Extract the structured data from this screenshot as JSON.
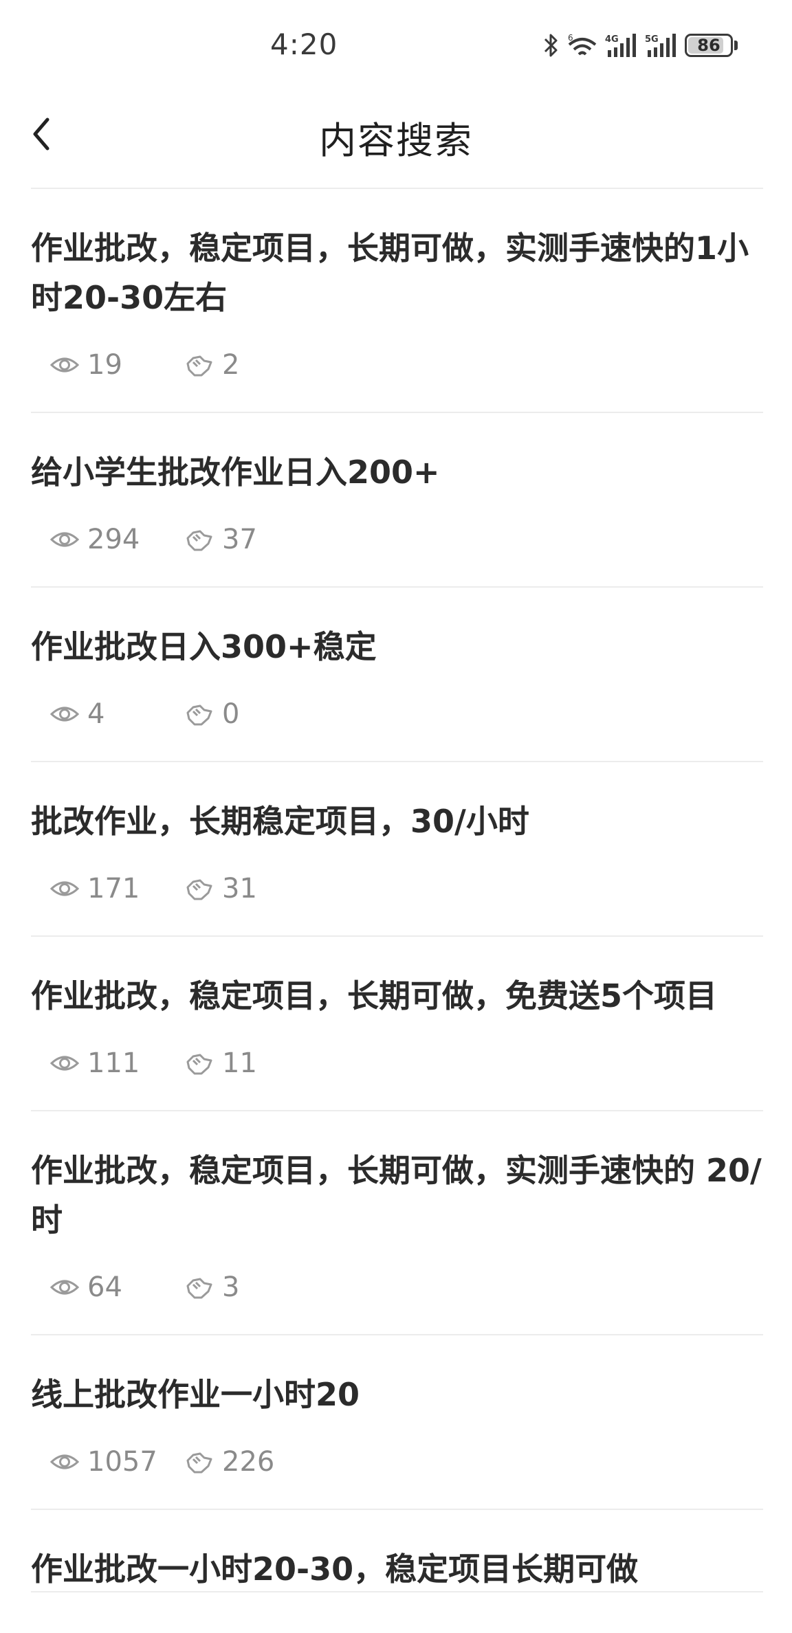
{
  "status": {
    "time": "4:20",
    "battery": "86"
  },
  "header": {
    "title": "内容搜索"
  },
  "results": [
    {
      "title": "作业批改，稳定项目，长期可做，实测手速快的1小时20-30左右",
      "views": "19",
      "likes": "2"
    },
    {
      "title": "给小学生批改作业日入200+",
      "views": "294",
      "likes": "37"
    },
    {
      "title": "作业批改日入300+稳定",
      "views": "4",
      "likes": "0"
    },
    {
      "title": "批改作业，长期稳定项目，30/小时",
      "views": "171",
      "likes": "31"
    },
    {
      "title": "作业批改，稳定项目，长期可做，免费送5个项目",
      "views": "111",
      "likes": "11"
    },
    {
      "title": "作业批改，稳定项目，长期可做，实测手速快的 20/时",
      "views": "64",
      "likes": "3"
    },
    {
      "title": "线上批改作业一小时20",
      "views": "1057",
      "likes": "226"
    },
    {
      "title": "作业批改一小时20-30，稳定项目长期可做"
    }
  ]
}
